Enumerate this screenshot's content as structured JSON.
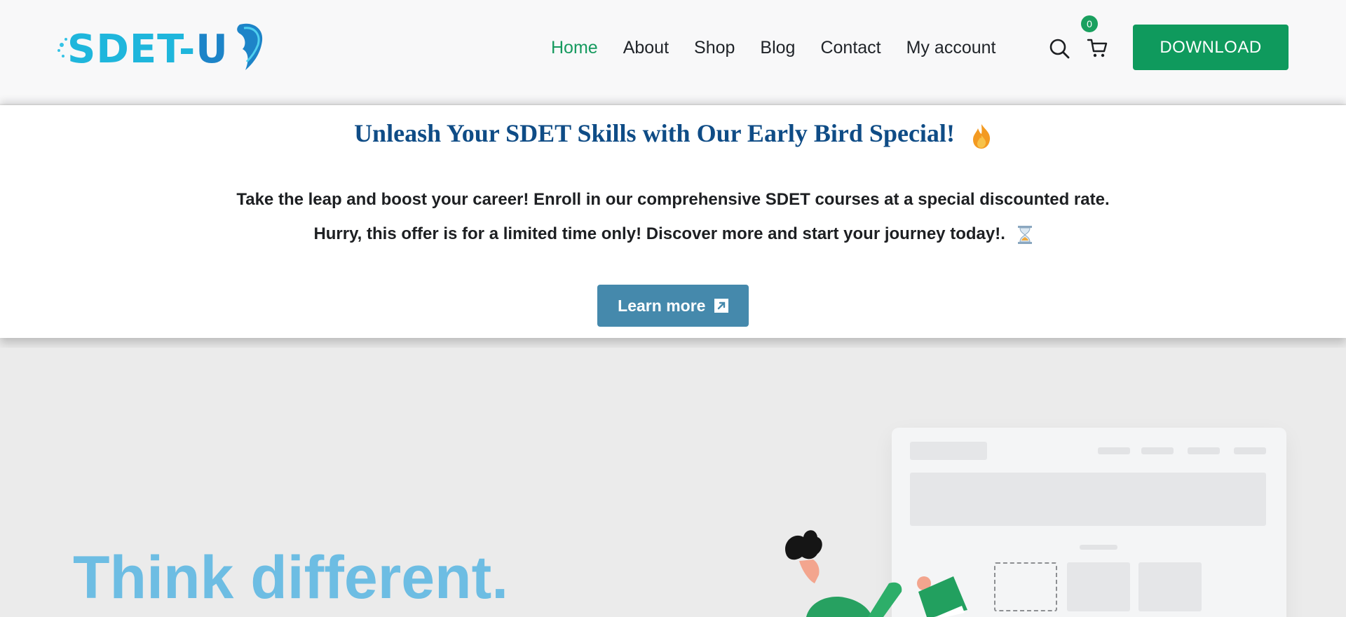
{
  "header": {
    "logo_text": "SDET-U",
    "nav": [
      {
        "label": "Home",
        "active": true
      },
      {
        "label": "About"
      },
      {
        "label": "Shop"
      },
      {
        "label": "Blog"
      },
      {
        "label": "Contact"
      },
      {
        "label": "My account"
      }
    ],
    "cart_count": "0",
    "download_label": "DOWNLOAD",
    "accent_color": "#169a5f"
  },
  "promo": {
    "title": "Unleash Your SDET Skills with Our Early Bird Special!",
    "line1": "Take the leap and boost your career! Enroll in our comprehensive SDET courses at a special discounted rate.",
    "line2": "Hurry, this offer is for a limited time only! Discover more and start your journey today!.",
    "button_label": "Learn more",
    "title_color": "#0f4c86",
    "button_color": "#4589ac"
  },
  "hero": {
    "title": "Think different.",
    "title_color": "#6dbde3"
  }
}
